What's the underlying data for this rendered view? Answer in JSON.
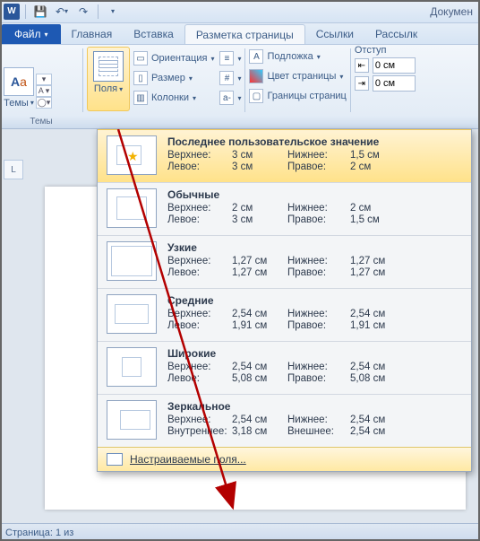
{
  "titlebar": {
    "doc_title": "Докумен"
  },
  "qat": {
    "save": "💾",
    "undo": "↶",
    "redo": "↷"
  },
  "tabs": {
    "file": "Файл",
    "home": "Главная",
    "insert": "Вставка",
    "page_layout": "Разметка страницы",
    "references": "Ссылки",
    "mailings": "Рассылк"
  },
  "ribbon": {
    "themes": {
      "label": "Темы",
      "group": "Темы"
    },
    "margins": "Поля",
    "orientation": "Ориентация",
    "size": "Размер",
    "columns": "Колонки",
    "watermark": "Подложка",
    "page_color": "Цвет страницы",
    "borders": "Границы страниц",
    "indent_label": "Отступ",
    "indent_left": "0 см",
    "indent_right": "0 см"
  },
  "dropdown": {
    "items": [
      {
        "title": "Последнее пользовательское значение",
        "thumb": "t-last",
        "top_l": "Верхнее:",
        "top_v": "3 см",
        "bot_l": "Нижнее:",
        "bot_v": "1,5 см",
        "left_l": "Левое:",
        "left_v": "3 см",
        "right_l": "Правое:",
        "right_v": "2 см"
      },
      {
        "title": "Обычные",
        "thumb": "t-normal",
        "top_l": "Верхнее:",
        "top_v": "2 см",
        "bot_l": "Нижнее:",
        "bot_v": "2 см",
        "left_l": "Левое:",
        "left_v": "3 см",
        "right_l": "Правое:",
        "right_v": "1,5 см"
      },
      {
        "title": "Узкие",
        "thumb": "t-narrow",
        "top_l": "Верхнее:",
        "top_v": "1,27 см",
        "bot_l": "Нижнее:",
        "bot_v": "1,27 см",
        "left_l": "Левое:",
        "left_v": "1,27 см",
        "right_l": "Правое:",
        "right_v": "1,27 см"
      },
      {
        "title": "Средние",
        "thumb": "t-moderate",
        "top_l": "Верхнее:",
        "top_v": "2,54 см",
        "bot_l": "Нижнее:",
        "bot_v": "2,54 см",
        "left_l": "Левое:",
        "left_v": "1,91 см",
        "right_l": "Правое:",
        "right_v": "1,91 см"
      },
      {
        "title": "Широкие",
        "thumb": "t-wide",
        "top_l": "Верхнее:",
        "top_v": "2,54 см",
        "bot_l": "Нижнее:",
        "bot_v": "2,54 см",
        "left_l": "Левое:",
        "left_v": "5,08 см",
        "right_l": "Правое:",
        "right_v": "5,08 см"
      },
      {
        "title": "Зеркальное",
        "thumb": "t-mirror",
        "top_l": "Верхнее:",
        "top_v": "2,54 см",
        "bot_l": "Нижнее:",
        "bot_v": "2,54 см",
        "left_l": "Внутреннее:",
        "left_v": "3,18 см",
        "right_l": "Внешнее:",
        "right_v": "2,54 см"
      }
    ],
    "custom": "Настраиваемые поля..."
  },
  "status": {
    "page": "Страница: 1 из"
  },
  "ruler_corner": "L"
}
